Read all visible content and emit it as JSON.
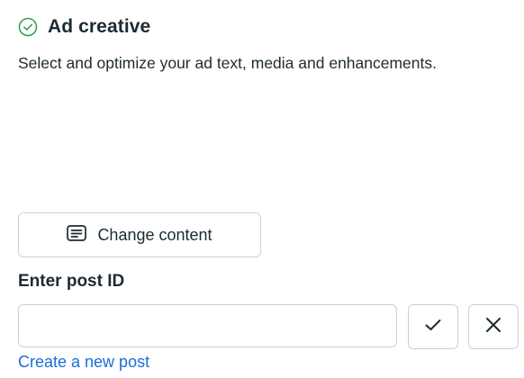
{
  "section": {
    "icon": "check-circle-icon",
    "title": "Ad creative",
    "description": "Select and optimize your ad text, media and enhancements."
  },
  "change_content": {
    "icon": "post-content-icon",
    "label": "Change content"
  },
  "post_id": {
    "label": "Enter post ID",
    "value": "",
    "placeholder": "",
    "confirm_icon": "checkmark-icon",
    "cancel_icon": "close-icon"
  },
  "create_post_link": "Create a new post",
  "colors": {
    "text": "#1c2b33",
    "link": "#1a6ed8",
    "success": "#31a24c",
    "border": "#ccd0d5"
  }
}
